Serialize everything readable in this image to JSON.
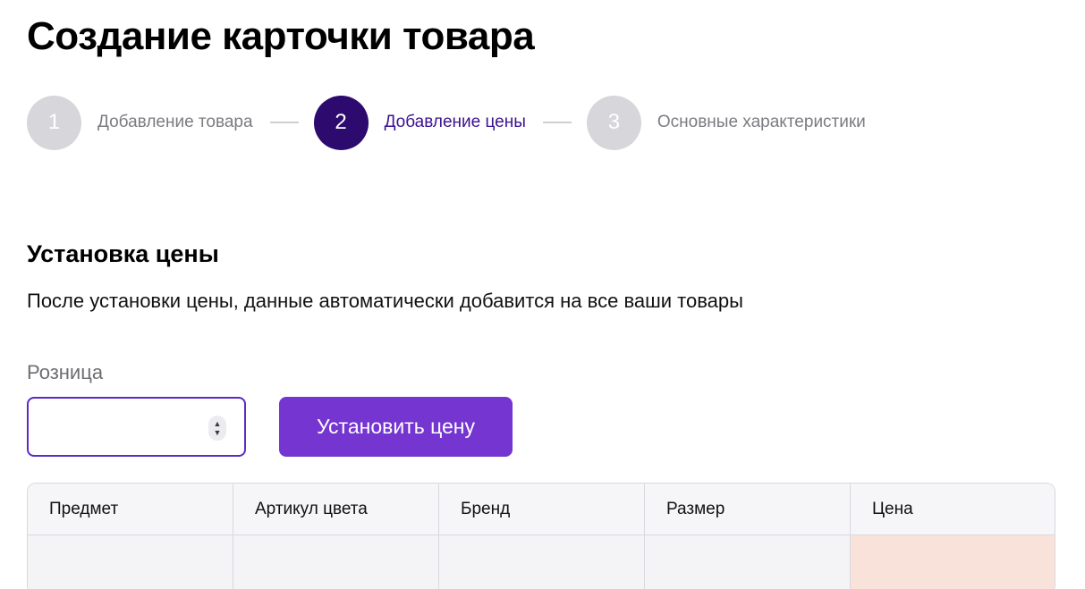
{
  "page": {
    "title": "Создание карточки товара"
  },
  "stepper": {
    "steps": [
      {
        "number": "1",
        "label": "Добавление товара",
        "state": "inactive"
      },
      {
        "number": "2",
        "label": "Добавление цены",
        "state": "active"
      },
      {
        "number": "3",
        "label": "Основные характеристики",
        "state": "inactive"
      }
    ]
  },
  "section": {
    "title": "Установка цены",
    "description": "После установки цены, данные автоматически добавится на все ваши товары"
  },
  "price_form": {
    "label": "Розница",
    "value": "",
    "button_label": "Установить цену",
    "spinner_up": "▲",
    "spinner_down": "▼"
  },
  "table": {
    "columns": [
      "Предмет",
      "Артикул цвета",
      "Бренд",
      "Размер",
      "Цена"
    ]
  },
  "colors": {
    "accent": "#7435d0",
    "active_step": "#2c0a6e",
    "inactive_step": "#d7d6db",
    "price_cell_bg": "#f8e2da"
  }
}
